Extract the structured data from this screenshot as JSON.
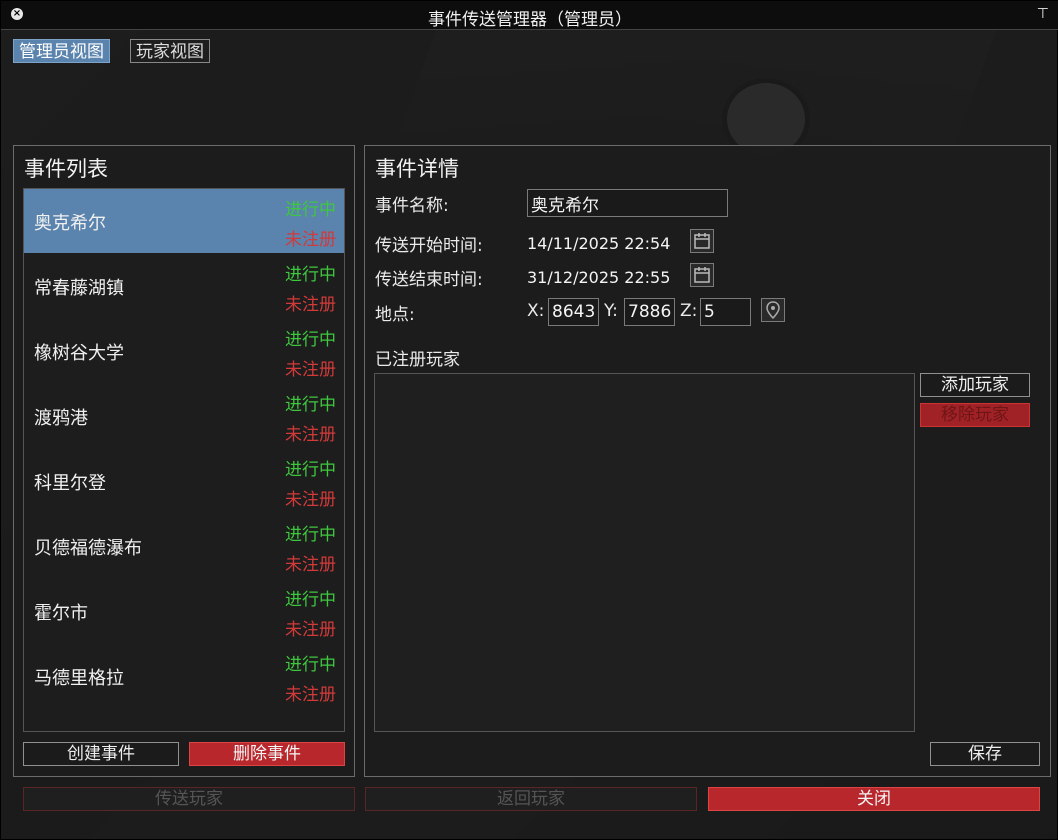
{
  "window": {
    "title": "事件传送管理器（管理员）"
  },
  "tabs": [
    {
      "label": "管理员视图"
    },
    {
      "label": "玩家视图"
    }
  ],
  "event_list": {
    "title": "事件列表",
    "items": [
      {
        "name": "奥克希尔",
        "status1": "进行中",
        "status2": "未注册"
      },
      {
        "name": "常春藤湖镇",
        "status1": "进行中",
        "status2": "未注册"
      },
      {
        "name": "橡树谷大学",
        "status1": "进行中",
        "status2": "未注册"
      },
      {
        "name": "渡鸦港",
        "status1": "进行中",
        "status2": "未注册"
      },
      {
        "name": "科里尔登",
        "status1": "进行中",
        "status2": "未注册"
      },
      {
        "name": "贝德福德瀑布",
        "status1": "进行中",
        "status2": "未注册"
      },
      {
        "name": "霍尔市",
        "status1": "进行中",
        "status2": "未注册"
      },
      {
        "name": "马德里格拉",
        "status1": "进行中",
        "status2": "未注册"
      }
    ],
    "create_button": "创建事件",
    "delete_button": "删除事件"
  },
  "details": {
    "title": "事件详情",
    "name_label": "事件名称:",
    "name_value": "奥克希尔",
    "start_label": "传送开始时间:",
    "start_value": "14/11/2025 22:54",
    "end_label": "传送结束时间:",
    "end_value": "31/12/2025 22:55",
    "location_label": "地点:",
    "x_label": "X:",
    "x_value": "8643",
    "y_label": "Y:",
    "y_value": "7886",
    "z_label": "Z:",
    "z_value": "5",
    "players_label": "已注册玩家",
    "add_player_button": "添加玩家",
    "remove_player_button": "移除玩家",
    "save_button": "保存"
  },
  "footer": {
    "teleport_button": "传送玩家",
    "return_button": "返回玩家",
    "close_button": "关闭"
  },
  "colors": {
    "accent": "#5a83ad",
    "status_active": "#3ec83e",
    "status_unregistered": "#d23a3a",
    "danger": "#b8272c"
  }
}
